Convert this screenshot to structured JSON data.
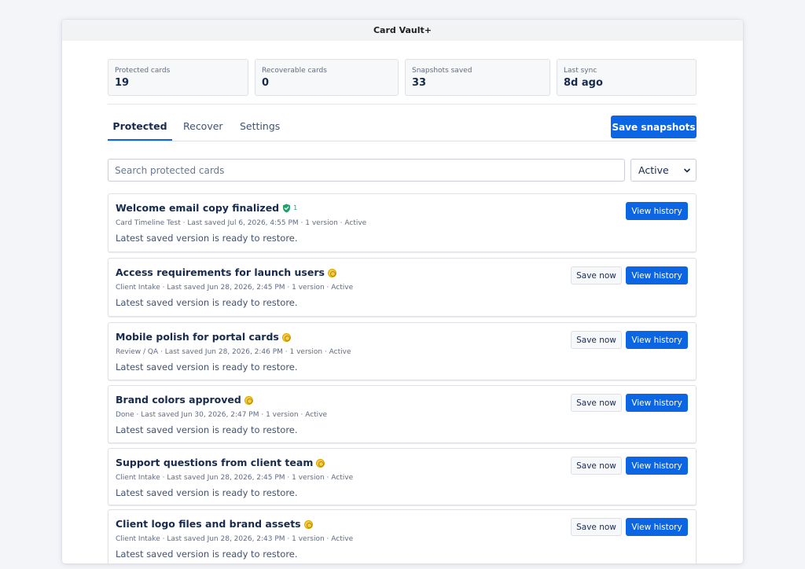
{
  "window": {
    "title": "Card Vault+"
  },
  "stats": [
    {
      "label": "Protected cards",
      "value": "19"
    },
    {
      "label": "Recoverable cards",
      "value": "0"
    },
    {
      "label": "Snapshots saved",
      "value": "33"
    },
    {
      "label": "Last sync",
      "value": "8d ago"
    }
  ],
  "tabs": [
    {
      "label": "Protected",
      "active": true
    },
    {
      "label": "Recover",
      "active": false
    },
    {
      "label": "Settings",
      "active": false
    }
  ],
  "toolbar": {
    "save_snapshots_label": "Save snapshots"
  },
  "filter": {
    "search_placeholder": "Search protected cards",
    "search_value": "",
    "status_selected": "Active"
  },
  "cards": [
    {
      "title": "Welcome email copy finalized",
      "badge": "protected",
      "badge_count": "1",
      "meta": "Card Timeline Test · Last saved Jul 6, 2026, 4:55 PM · 1 version · Active",
      "desc": "Latest saved version is ready to restore.",
      "save_now_label": "",
      "view_history_label": "View history"
    },
    {
      "title": "Access requirements for launch users",
      "badge": "pending",
      "meta": "Client Intake · Last saved Jun 28, 2026, 2:45 PM · 1 version · Active",
      "desc": "Latest saved version is ready to restore.",
      "save_now_label": "Save now",
      "view_history_label": "View history"
    },
    {
      "title": "Mobile polish for portal cards",
      "badge": "pending",
      "meta": "Review / QA · Last saved Jun 28, 2026, 2:46 PM · 1 version · Active",
      "desc": "Latest saved version is ready to restore.",
      "save_now_label": "Save now",
      "view_history_label": "View history"
    },
    {
      "title": "Brand colors approved",
      "badge": "pending",
      "meta": "Done · Last saved Jun 30, 2026, 2:47 PM · 1 version · Active",
      "desc": "Latest saved version is ready to restore.",
      "save_now_label": "Save now",
      "view_history_label": "View history"
    },
    {
      "title": "Support questions from client team",
      "badge": "pending",
      "meta": "Client Intake · Last saved Jun 28, 2026, 2:45 PM · 1 version · Active",
      "desc": "Latest saved version is ready to restore.",
      "save_now_label": "Save now",
      "view_history_label": "View history"
    },
    {
      "title": "Client logo files and brand assets",
      "badge": "pending",
      "meta": "Client Intake · Last saved Jun 28, 2026, 2:43 PM · 1 version · Active",
      "desc": "Latest saved version is ready to restore.",
      "save_now_label": "Save now",
      "view_history_label": "View history"
    }
  ],
  "colors": {
    "accent": "#0c66e4",
    "protected_badge": "#22a06b",
    "pending_badge": "#f5cd47"
  },
  "icons": {
    "protected_badge": "shield-check-icon",
    "pending_badge": "pending-dot-icon",
    "select_chevron": "chevron-down-icon"
  }
}
